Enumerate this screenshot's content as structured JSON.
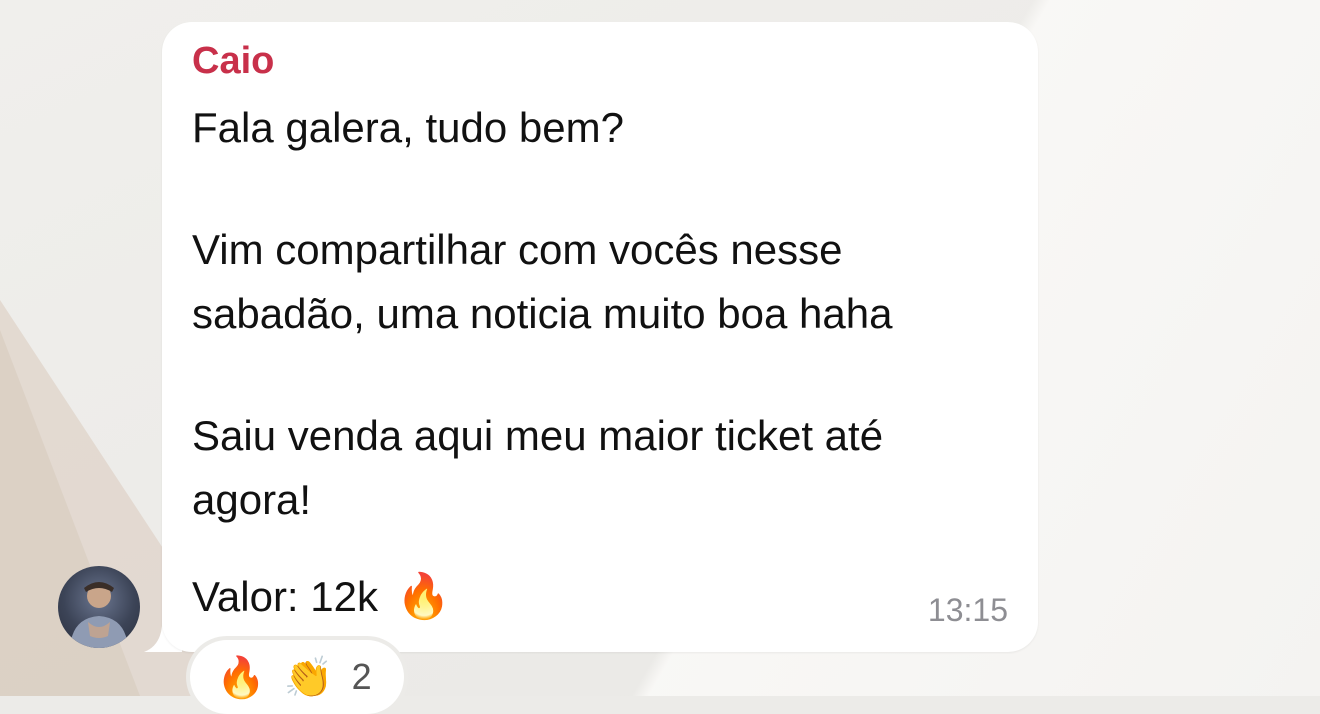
{
  "message": {
    "sender": "Caio",
    "line1": "Fala galera, tudo bem?",
    "para2_line1": "Vim compartilhar com vocês nesse",
    "para2_line2": "sabadão, uma noticia muito boa haha",
    "para3_line1": "Saiu venda aqui meu maior ticket até",
    "para3_line2": "agora!",
    "valor": "Valor: 12k",
    "valor_emoji": "🔥",
    "time": "13:15"
  },
  "reactions": {
    "emoji1": "🔥",
    "emoji2": "👏",
    "count": "2"
  },
  "colors": {
    "sender": "#c8304a",
    "bubble": "#ffffff",
    "timestamp": "#8e8e93"
  }
}
